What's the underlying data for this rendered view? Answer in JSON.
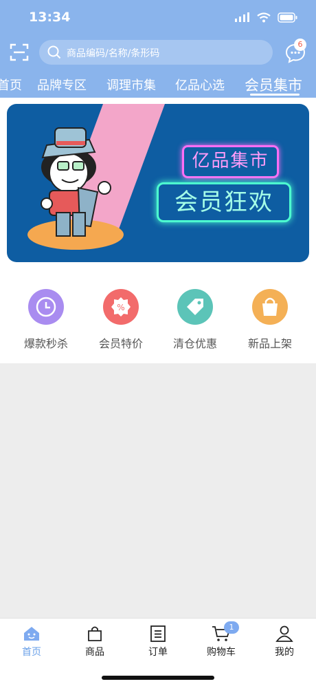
{
  "status": {
    "time": "13:34"
  },
  "search": {
    "placeholder": "商品编码/名称/条形码"
  },
  "messages": {
    "badge_count": "6"
  },
  "tabs": [
    {
      "label": "首页"
    },
    {
      "label": "品牌专区"
    },
    {
      "label": "调理市集"
    },
    {
      "label": "亿品心选"
    },
    {
      "label": "会员集市"
    }
  ],
  "banner": {
    "line1": "亿品集市",
    "line2": "会员狂欢"
  },
  "quick_links": [
    {
      "label": "爆款秒杀",
      "color": "#a98cf0"
    },
    {
      "label": "会员特价",
      "color": "#f26b6b"
    },
    {
      "label": "清仓优惠",
      "color": "#5cc4b8"
    },
    {
      "label": "新品上架",
      "color": "#f4b056"
    }
  ],
  "bottom_nav": [
    {
      "label": "首页",
      "active": true
    },
    {
      "label": "商品"
    },
    {
      "label": "订单"
    },
    {
      "label": "购物车"
    },
    {
      "label": "我的"
    }
  ],
  "cart": {
    "badge_count": "1"
  },
  "colors": {
    "header": "#8ab4ec",
    "active_tab": "#6aa0e8",
    "banner_bg": "#0e5da2"
  }
}
